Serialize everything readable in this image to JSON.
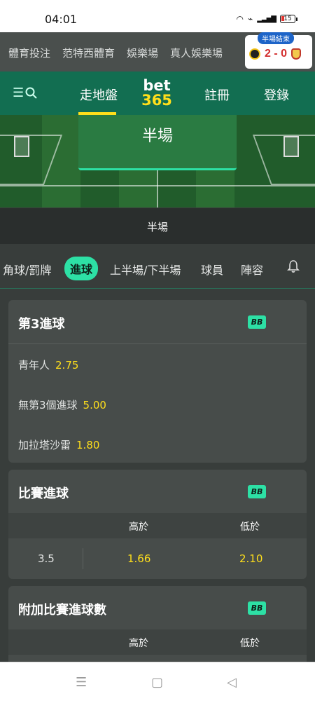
{
  "status": {
    "time": "04:01",
    "battery": "15"
  },
  "top_nav": {
    "links": [
      "體育投注",
      "范特西體育",
      "娛樂場",
      "真人娛樂場"
    ]
  },
  "scorecard": {
    "badge": "半場結束",
    "score": "2 - 0"
  },
  "header": {
    "live": "走地盤",
    "logo_top": "bet",
    "logo_bottom": "365",
    "register": "註冊",
    "login": "登錄"
  },
  "pitch": {
    "card_label": "半場",
    "status": "半場"
  },
  "tabs": [
    {
      "label": "角球/罰牌",
      "active": false
    },
    {
      "label": "進球",
      "active": true
    },
    {
      "label": "上半場/下半場",
      "active": false
    },
    {
      "label": "球員",
      "active": false
    },
    {
      "label": "陣容",
      "active": false
    }
  ],
  "markets": {
    "third_goal": {
      "title": "第3進球",
      "badge": "BB",
      "selections": [
        {
          "name": "青年人",
          "odds": "2.75"
        },
        {
          "name": "無第3個進球",
          "odds": "5.00"
        },
        {
          "name": "加拉塔沙雷",
          "odds": "1.80"
        }
      ]
    },
    "match_goals": {
      "title": "比賽進球",
      "badge": "BB",
      "over_label": "高於",
      "under_label": "低於",
      "line": "3.5",
      "over": "1.66",
      "under": "2.10"
    },
    "alt_goals": {
      "title": "附加比賽進球數",
      "badge": "BB",
      "over_label": "高於",
      "under_label": "低於"
    }
  },
  "colors": {
    "accent": "#2de0a5",
    "brand": "#126e51",
    "odds": "#ffdf1b"
  }
}
